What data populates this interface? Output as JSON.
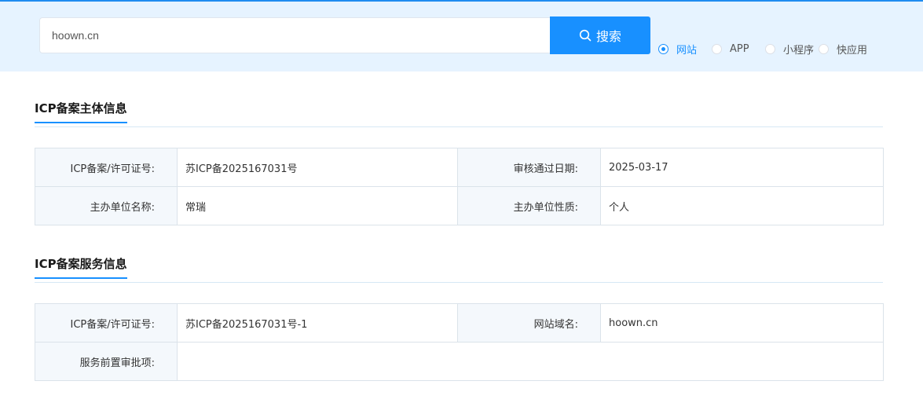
{
  "search": {
    "value": "hoown.cn",
    "button_label": "搜索"
  },
  "filters": [
    {
      "label": "网站",
      "checked": true
    },
    {
      "label": "APP",
      "checked": false
    },
    {
      "label": "小程序",
      "checked": false
    },
    {
      "label": "快应用",
      "checked": false
    }
  ],
  "colors": {
    "accent": "#1890ff",
    "band": "#e6f3ff",
    "label_bg": "#f4f8fc"
  },
  "subject_info": {
    "title": "ICP备案主体信息",
    "rows": [
      {
        "label1": "ICP备案/许可证号:",
        "value1": "苏ICP备2025167031号",
        "label2": "审核通过日期:",
        "value2": "2025-03-17"
      },
      {
        "label1": "主办单位名称:",
        "value1": "常瑞",
        "label2": "主办单位性质:",
        "value2": "个人"
      }
    ]
  },
  "service_info": {
    "title": "ICP备案服务信息",
    "rows": [
      {
        "label1": "ICP备案/许可证号:",
        "value1": "苏ICP备2025167031号-1",
        "label2": "网站域名:",
        "value2": "hoown.cn"
      },
      {
        "label1": "服务前置审批项:",
        "value1": ""
      }
    ]
  }
}
